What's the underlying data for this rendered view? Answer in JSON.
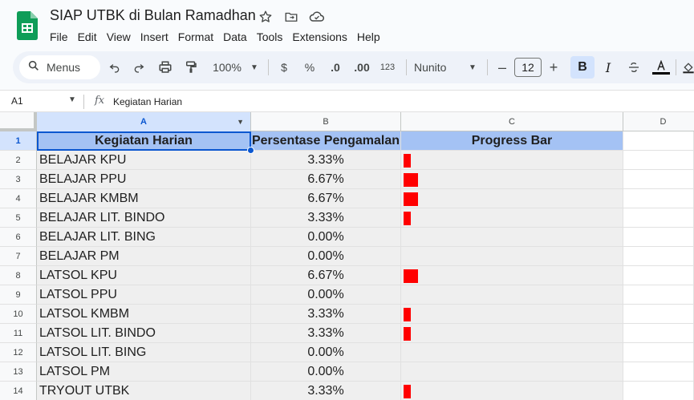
{
  "doc": {
    "title": "SIAP UTBK di Bulan Ramadhan",
    "menus": [
      "File",
      "Edit",
      "View",
      "Insert",
      "Format",
      "Data",
      "Tools",
      "Extensions",
      "Help"
    ]
  },
  "toolbar": {
    "search_label": "Menus",
    "zoom": "100%",
    "currency": "$",
    "percent": "%",
    "dec_decrease": ".0",
    "dec_increase": ".00",
    "number_format": "123",
    "font": "Nunito",
    "font_size": "12",
    "bold": "B",
    "italic": "I"
  },
  "formula_bar": {
    "cell_ref": "A1",
    "fx": "fx",
    "content": "Kegiatan Harian"
  },
  "columns": [
    "A",
    "B",
    "C",
    "D"
  ],
  "header_row": {
    "row_number": "1",
    "col_a": "Kegiatan Harian",
    "col_b": "Persentase Pengamalan",
    "col_c": "Progress Bar"
  },
  "rows": [
    {
      "n": "2",
      "activity": "BELAJAR KPU",
      "percent": "3.33%",
      "progress": 0.0333
    },
    {
      "n": "3",
      "activity": "BELAJAR PPU",
      "percent": "6.67%",
      "progress": 0.0667
    },
    {
      "n": "4",
      "activity": "BELAJAR KMBM",
      "percent": "6.67%",
      "progress": 0.0667
    },
    {
      "n": "5",
      "activity": "BELAJAR LIT. BINDO",
      "percent": "3.33%",
      "progress": 0.0333
    },
    {
      "n": "6",
      "activity": "BELAJAR LIT. BING",
      "percent": "0.00%",
      "progress": 0
    },
    {
      "n": "7",
      "activity": "BELAJAR PM",
      "percent": "0.00%",
      "progress": 0
    },
    {
      "n": "8",
      "activity": "LATSOL KPU",
      "percent": "6.67%",
      "progress": 0.0667
    },
    {
      "n": "9",
      "activity": "LATSOL PPU",
      "percent": "0.00%",
      "progress": 0
    },
    {
      "n": "10",
      "activity": "LATSOL KMBM",
      "percent": "3.33%",
      "progress": 0.0333
    },
    {
      "n": "11",
      "activity": "LATSOL LIT. BINDO",
      "percent": "3.33%",
      "progress": 0.0333
    },
    {
      "n": "12",
      "activity": "LATSOL LIT. BING",
      "percent": "0.00%",
      "progress": 0
    },
    {
      "n": "13",
      "activity": "LATSOL PM",
      "percent": "0.00%",
      "progress": 0
    },
    {
      "n": "14",
      "activity": "TRYOUT UTBK",
      "percent": "3.33%",
      "progress": 0.0333
    }
  ],
  "colors": {
    "header_fill": "#a4c2f4",
    "cell_fill": "#efefef",
    "bar_fill": "#ff0000",
    "selection": "#0b57d0"
  }
}
